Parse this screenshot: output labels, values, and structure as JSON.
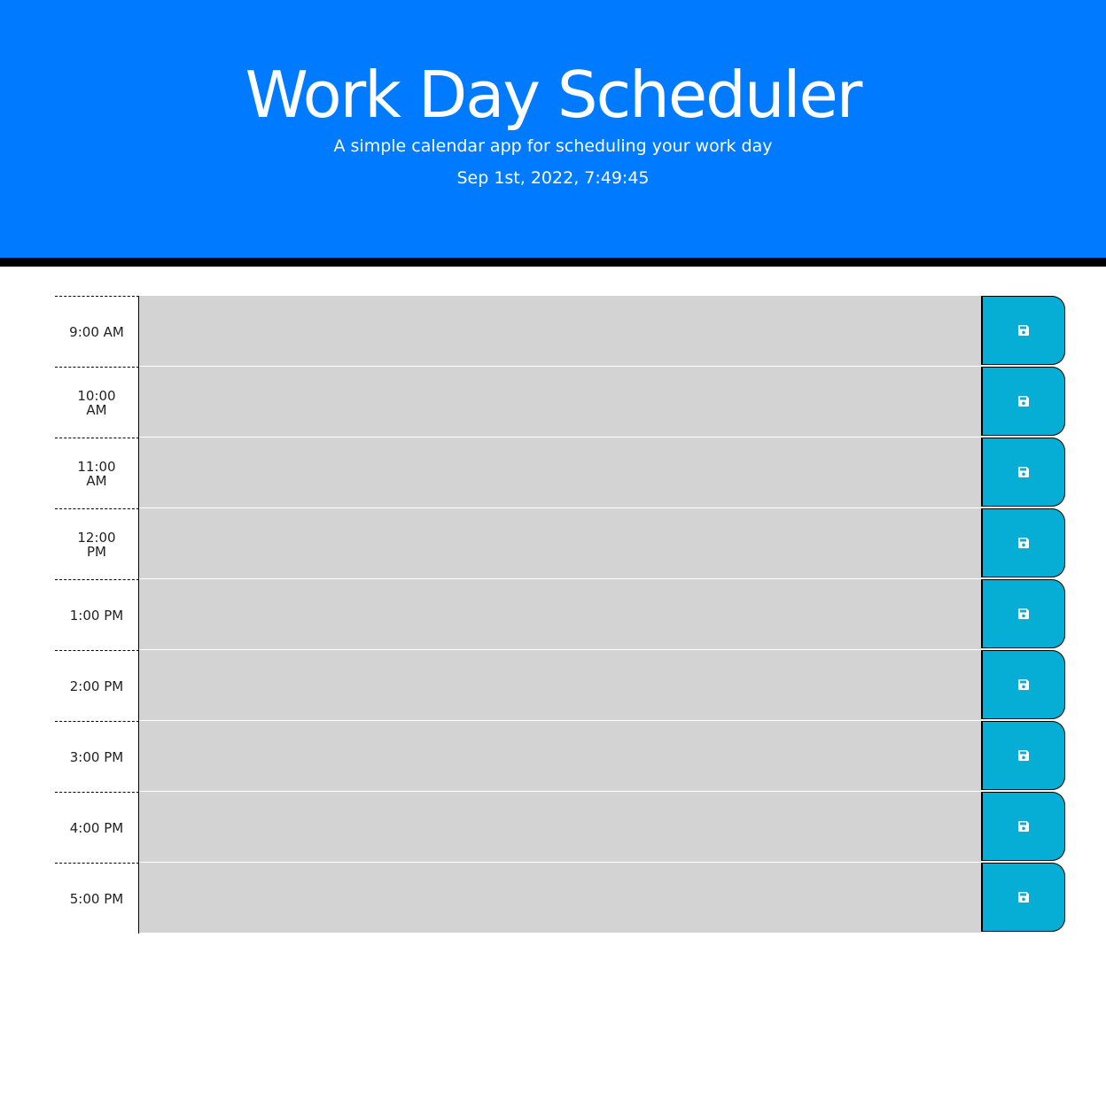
{
  "header": {
    "title": "Work Day Scheduler",
    "subtitle": "A simple calendar app for scheduling your work day",
    "current_date": "Sep 1st, 2022, 7:49:45"
  },
  "colors": {
    "header_bg": "#007bff",
    "time_block_bg": "#d3d3d3",
    "save_button_bg": "#06aed5"
  },
  "time_blocks": [
    {
      "hour": "9:00 AM",
      "text": ""
    },
    {
      "hour": "10:00 AM",
      "text": ""
    },
    {
      "hour": "11:00 AM",
      "text": ""
    },
    {
      "hour": "12:00 PM",
      "text": ""
    },
    {
      "hour": "1:00 PM",
      "text": ""
    },
    {
      "hour": "2:00 PM",
      "text": ""
    },
    {
      "hour": "3:00 PM",
      "text": ""
    },
    {
      "hour": "4:00 PM",
      "text": ""
    },
    {
      "hour": "5:00 PM",
      "text": ""
    }
  ],
  "save_icon": "floppy-disk-icon"
}
